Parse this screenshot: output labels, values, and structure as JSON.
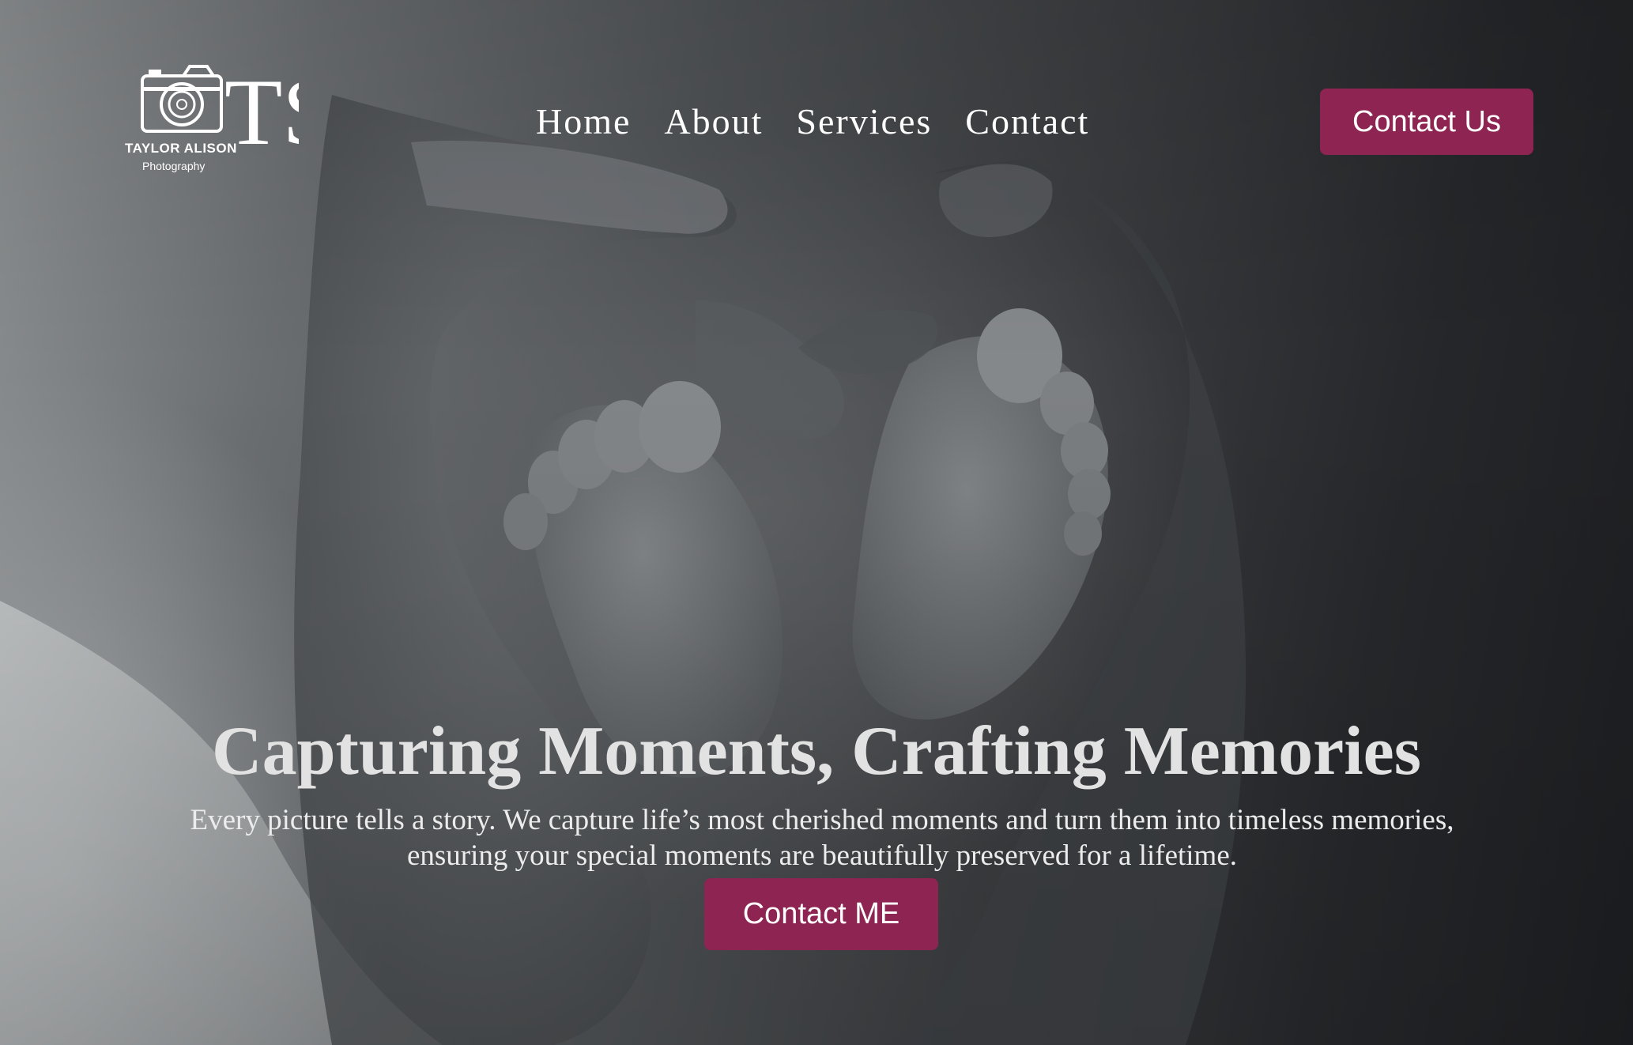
{
  "brand": {
    "name": "TAYLOR ALISON",
    "tagline": "Photography",
    "monogram": "TS"
  },
  "nav": {
    "items": [
      {
        "label": "Home"
      },
      {
        "label": "About"
      },
      {
        "label": "Services"
      },
      {
        "label": "Contact"
      }
    ]
  },
  "header": {
    "cta_label": "Contact Us"
  },
  "hero": {
    "headline": "Capturing Moments, Crafting Memories",
    "subtext": "Every picture tells a story. We capture life’s most cherished moments and turn them into timeless memories, ensuring your special moments are beautifully preserved for a lifetime.",
    "cta_label": "Contact ME",
    "background_image": "black-and-white photo of parents' hands forming a heart around baby feet"
  },
  "colors": {
    "accent": "#8e2451",
    "text_light": "#ffffff",
    "headline": "#e2e2e2"
  },
  "icons": {
    "logo": "camera-icon"
  }
}
